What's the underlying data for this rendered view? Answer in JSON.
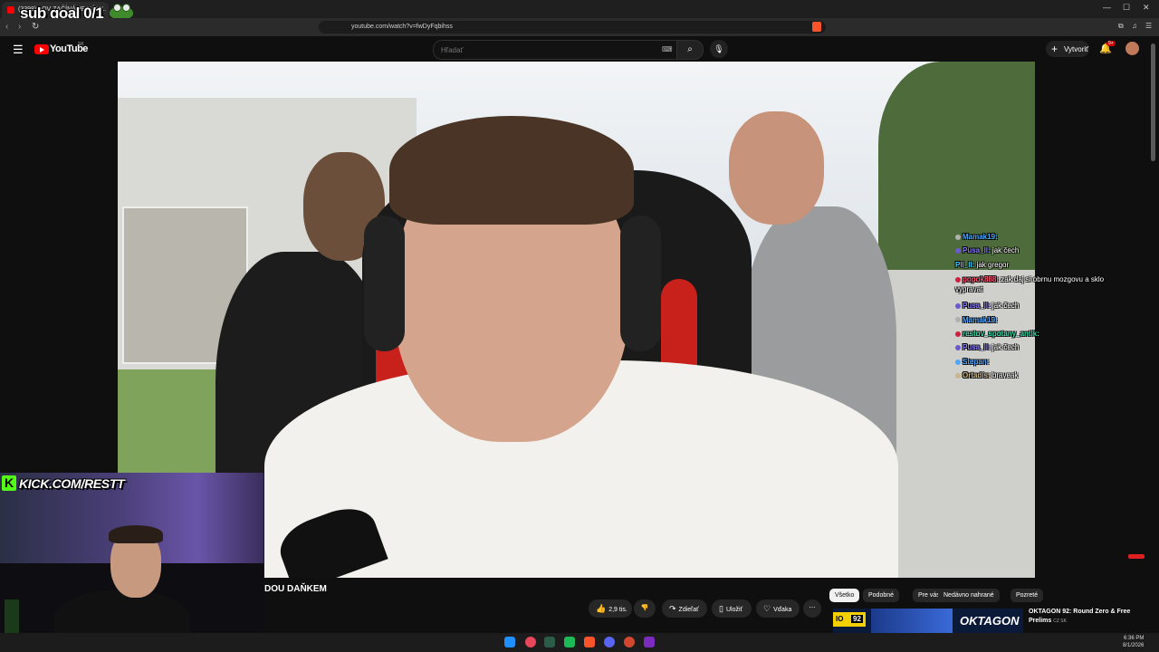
{
  "browser": {
    "tab_title": "(3398) LOV ZAČÍNÁ JE NÁM...",
    "url": "youtube.com/watch?v=fwDyFqbihss",
    "overlay_text": "sub goal 0/1"
  },
  "youtube": {
    "logo_text": "YouTube",
    "region": "SK",
    "search_placeholder": "Hľadať",
    "create_label": "Vytvoriť",
    "notif_count": "9+"
  },
  "video": {
    "title": "DOU DAŇKEM",
    "likes": "2,9 tis.",
    "actions": {
      "share": "Zdieľať",
      "save": "Uložiť",
      "thanks": "Vďaka"
    }
  },
  "chat": [
    {
      "name": "Mamak19:",
      "msg": "",
      "color": "#4ea6ff",
      "dot": "#b0b0b0"
    },
    {
      "name": "Pusa_Il:",
      "msg": "jak čech",
      "color": "#8a7cff",
      "dot": "#6a5acd"
    },
    {
      "name": "Pll_Il:",
      "msg": "jak gregor",
      "color": "#3fd0ff",
      "dot": "#2ca3d6"
    },
    {
      "name": "popok888:",
      "msg": "zak daj si obrnu mozgovu a sklo vypravat",
      "color": "#ff4d6d",
      "dot": "#d02040"
    },
    {
      "name": "Pusa_Il:",
      "msg": "jak čech",
      "color": "#8a7cff",
      "dot": "#6a5acd"
    },
    {
      "name": "Mamak19:",
      "msg": "",
      "color": "#4ea6ff",
      "dot": "#b0b0b0"
    },
    {
      "name": "restov_spotany_antik:",
      "msg": "",
      "color": "#33ddaa",
      "dot": "#d02040"
    },
    {
      "name": "Pusa_Il:",
      "msg": "jak čech",
      "color": "#8a7cff",
      "dot": "#6a5acd"
    },
    {
      "name": "Stepan:",
      "msg": "",
      "color": "#4ea6ff",
      "dot": "#4ea6ff"
    },
    {
      "name": "Ortadis:",
      "msg": "braveak",
      "color": "#c9b68a",
      "dot": "#c9b68a"
    }
  ],
  "facecam": {
    "kick_label": "KICK.COM/RESTT"
  },
  "chips": [
    "Všetko",
    "Podobné",
    "Pre vás",
    "Nedávno nahrané",
    "Pozreté"
  ],
  "recommended": {
    "title": "OKTAGON 92: Round Zero & Free Prelims",
    "channel": "OKTAGON",
    "suffix": "CZ SK",
    "badge_num": "92"
  },
  "taskbar": {
    "time": "6:36 PM",
    "date": "8/1/2026"
  }
}
